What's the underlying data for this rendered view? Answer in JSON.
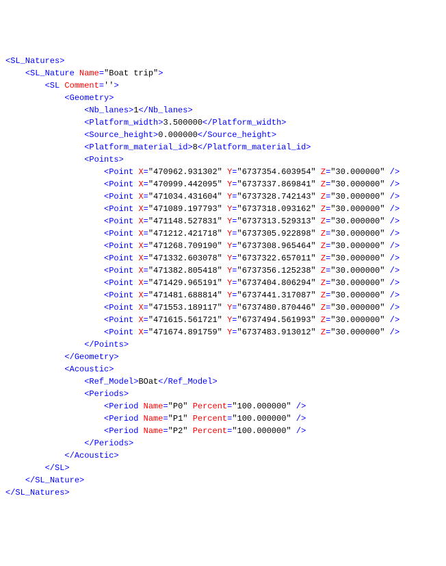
{
  "root": {
    "open": "<SL_Natures>",
    "close": "</SL_Natures>"
  },
  "nature": {
    "openStart": "<SL_Nature",
    "nameAttr": "Name",
    "nameVal": "\"Boat trip\"",
    "openEnd": ">",
    "close": "</SL_Nature>"
  },
  "sl": {
    "openStart": "<SL",
    "commentAttr": "Comment",
    "commentVal": "''",
    "openEnd": ">",
    "close": "</SL>"
  },
  "geometry": {
    "open": "<Geometry>",
    "close": "</Geometry>",
    "nbLanesOpen": "<Nb_lanes>",
    "nbLanesVal": "1",
    "nbLanesClose": "</Nb_lanes>",
    "pwOpen": "<Platform_width>",
    "pwVal": "3.500000",
    "pwClose": "</Platform_width>",
    "shOpen": "<Source_height>",
    "shVal": "0.000000",
    "shClose": "</Source_height>",
    "pmOpen": "<Platform_material_id>",
    "pmVal": "8",
    "pmClose": "</Platform_material_id>",
    "pointsOpen": "<Points>",
    "pointsClose": "</Points>",
    "pointStart": "<Point",
    "xAttr": "X",
    "yAttr": "Y",
    "zAttr": "Z",
    "selfClose": " />",
    "points": [
      {
        "x": "\"470962.931302\"",
        "y": "\"6737354.603954\"",
        "z": "\"30.000000\""
      },
      {
        "x": "\"470999.442095\"",
        "y": "\"6737337.869841\"",
        "z": "\"30.000000\""
      },
      {
        "x": "\"471034.431604\"",
        "y": "\"6737328.742143\"",
        "z": "\"30.000000\""
      },
      {
        "x": "\"471089.197793\"",
        "y": "\"6737318.093162\"",
        "z": "\"30.000000\""
      },
      {
        "x": "\"471148.527831\"",
        "y": "\"6737313.529313\"",
        "z": "\"30.000000\""
      },
      {
        "x": "\"471212.421718\"",
        "y": "\"6737305.922898\"",
        "z": "\"30.000000\""
      },
      {
        "x": "\"471268.709190\"",
        "y": "\"6737308.965464\"",
        "z": "\"30.000000\""
      },
      {
        "x": "\"471332.603078\"",
        "y": "\"6737322.657011\"",
        "z": "\"30.000000\""
      },
      {
        "x": "\"471382.805418\"",
        "y": "\"6737356.125238\"",
        "z": "\"30.000000\""
      },
      {
        "x": "\"471429.965191\"",
        "y": "\"6737404.806294\"",
        "z": "\"30.000000\""
      },
      {
        "x": "\"471481.688814\"",
        "y": "\"6737441.317087\"",
        "z": "\"30.000000\""
      },
      {
        "x": "\"471553.189117\"",
        "y": "\"6737480.870446\"",
        "z": "\"30.000000\""
      },
      {
        "x": "\"471615.561721\"",
        "y": "\"6737494.561993\"",
        "z": "\"30.000000\""
      },
      {
        "x": "\"471674.891759\"",
        "y": "\"6737483.913012\"",
        "z": "\"30.000000\""
      }
    ]
  },
  "acoustic": {
    "open": "<Acoustic>",
    "close": "</Acoustic>",
    "refOpen": "<Ref_Model>",
    "refVal": "BOat",
    "refClose": "</Ref_Model>",
    "periodsOpen": "<Periods>",
    "periodsClose": "</Periods>",
    "periodStart": "<Period",
    "nameAttr": "Name",
    "percentAttr": "Percent",
    "selfClose": " />",
    "periods": [
      {
        "name": "\"P0\"",
        "percent": "\"100.000000\""
      },
      {
        "name": "\"P1\"",
        "percent": "\"100.000000\""
      },
      {
        "name": "\"P2\"",
        "percent": "\"100.000000\""
      }
    ]
  },
  "indent": {
    "i1": "    ",
    "i2": "        ",
    "i3": "            ",
    "i4": "                ",
    "i5": "                    ",
    "i6": "                        "
  }
}
